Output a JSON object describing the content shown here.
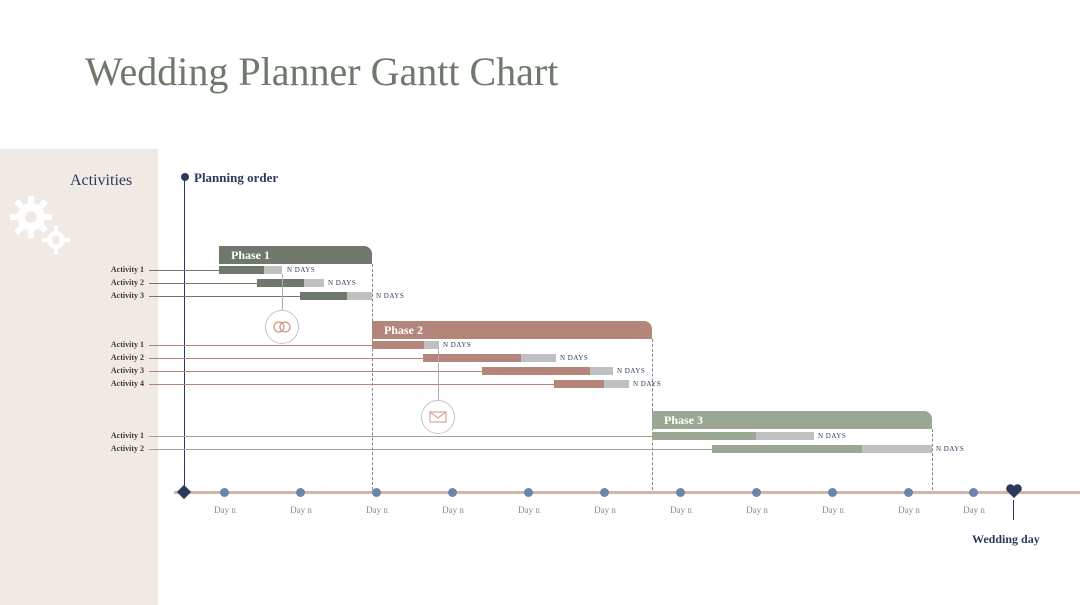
{
  "title": "Wedding Planner Gantt Chart",
  "activities_header": "Activities",
  "planning_order_label": "Planning order",
  "wedding_day_label": "Wedding day",
  "chart_data": {
    "type": "bar",
    "title": "Wedding Planner Gantt Chart",
    "xlabel": "Day n",
    "ylabel": "Activities",
    "timeline_ticks": [
      "Day n",
      "Day n",
      "Day n",
      "Day n",
      "Day n",
      "Day n",
      "Day n",
      "Day n",
      "Day n",
      "Day n",
      "Day n"
    ],
    "phases": [
      {
        "name": "Phase 1",
        "color": "#6e796c",
        "start_pct": 5,
        "end_pct": 31,
        "activities": [
          {
            "label": "Activity 1",
            "start_pct": 5,
            "bar_end_pct": 12,
            "ext_end_pct": 15,
            "duration": "N DAYS"
          },
          {
            "label": "Activity 2",
            "start_pct": 11,
            "bar_end_pct": 19,
            "ext_end_pct": 23,
            "duration": "N DAYS"
          },
          {
            "label": "Activity 3",
            "start_pct": 19,
            "bar_end_pct": 27,
            "ext_end_pct": 31,
            "duration": "N DAYS"
          }
        ]
      },
      {
        "name": "Phase 2",
        "color": "#b4857a",
        "start_pct": 31,
        "end_pct": 62,
        "activities": [
          {
            "label": "Activity 1",
            "start_pct": 31,
            "bar_end_pct": 37,
            "ext_end_pct": 39,
            "duration": "N DAYS"
          },
          {
            "label": "Activity 2",
            "start_pct": 37,
            "bar_end_pct": 48,
            "ext_end_pct": 52,
            "duration": "N DAYS"
          },
          {
            "label": "Activity 3",
            "start_pct": 44,
            "bar_end_pct": 56,
            "ext_end_pct": 58,
            "duration": "N DAYS"
          },
          {
            "label": "Activity 4",
            "start_pct": 52,
            "bar_end_pct": 57,
            "ext_end_pct": 60,
            "duration": "N DAYS"
          }
        ]
      },
      {
        "name": "Phase 3",
        "color": "#9aa893",
        "start_pct": 62,
        "end_pct": 93,
        "activities": [
          {
            "label": "Activity 1",
            "start_pct": 62,
            "bar_end_pct": 73,
            "ext_end_pct": 77,
            "duration": "N DAYS"
          },
          {
            "label": "Activity 2",
            "start_pct": 70,
            "bar_end_pct": 85,
            "ext_end_pct": 89,
            "duration": "N DAYS"
          }
        ]
      }
    ]
  }
}
